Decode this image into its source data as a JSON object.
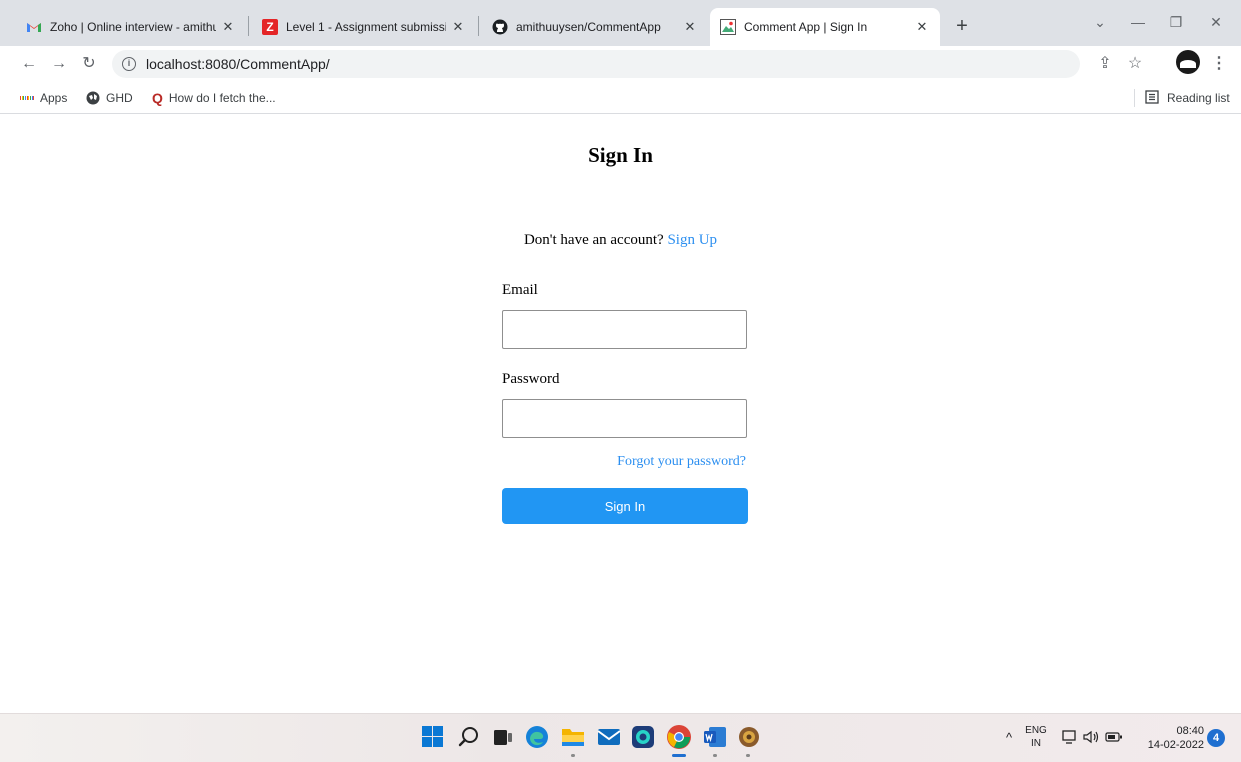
{
  "browser": {
    "tabs": [
      {
        "title": "Zoho | Online interview - amithu",
        "favicon": "gmail-icon"
      },
      {
        "title": "Level 1 - Assignment submission",
        "favicon": "zoho-icon"
      },
      {
        "title": "amithuuysen/CommentApp",
        "favicon": "github-icon"
      },
      {
        "title": "Comment App | Sign In",
        "favicon": "page-icon"
      }
    ],
    "url": "localhost:8080/CommentApp/",
    "bookmarks": [
      {
        "label": "Apps"
      },
      {
        "label": "GHD"
      },
      {
        "label": "How do I fetch the..."
      }
    ],
    "reading_list": "Reading list"
  },
  "page": {
    "title": "Sign In",
    "signup_prompt": "Don't have an account?",
    "signup_link": "Sign Up",
    "email_label": "Email",
    "email_value": "",
    "password_label": "Password",
    "password_value": "",
    "forgot_link": "Forgot your password?",
    "submit_label": "Sign In"
  },
  "taskbar": {
    "lang_top": "ENG",
    "lang_bottom": "IN",
    "time": "08:40",
    "date": "14-02-2022",
    "notification_count": "4"
  },
  "colors": {
    "link": "#2c8ff0",
    "primary_button": "#2196f3",
    "tabstrip": "#dee1e6"
  }
}
